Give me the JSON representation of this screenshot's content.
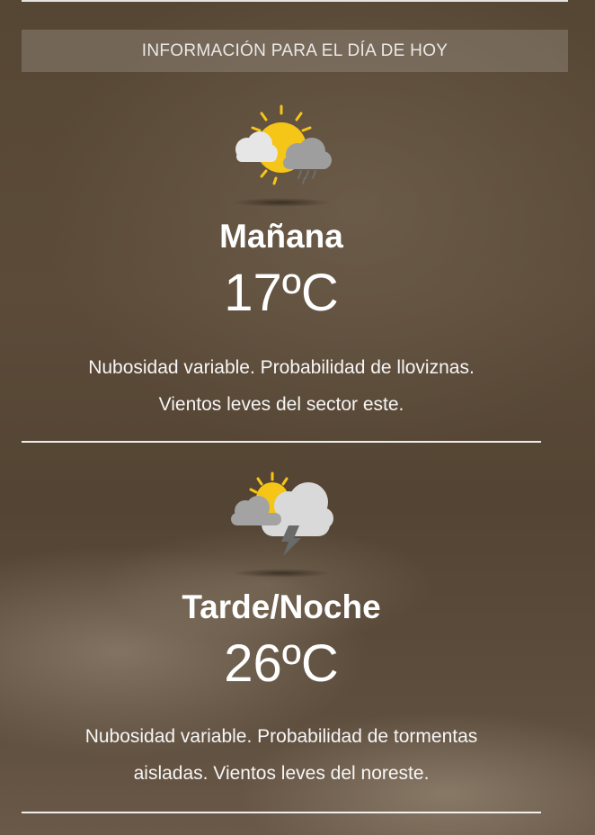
{
  "header": {
    "title": "INFORMACIÓN PARA EL DÍA DE HOY"
  },
  "forecast": [
    {
      "period": "Mañana",
      "temperature": "17ºC",
      "description_line1": "Nubosidad variable. Probabilidad de lloviznas.",
      "description_line2": "Vientos leves del sector este.",
      "icon": "sun-cloud-drizzle-icon"
    },
    {
      "period": "Tarde/Noche",
      "temperature": "26ºC",
      "description_line1": "Nubosidad variable. Probabilidad de tormentas",
      "description_line2": "aisladas. Vientos leves del noreste.",
      "icon": "sun-cloud-thunder-icon"
    }
  ],
  "colors": {
    "sun": "#f5c518",
    "cloud_light": "#dcdcdc",
    "cloud_dark": "#9a9a9a",
    "background": "#5a4a3a"
  }
}
